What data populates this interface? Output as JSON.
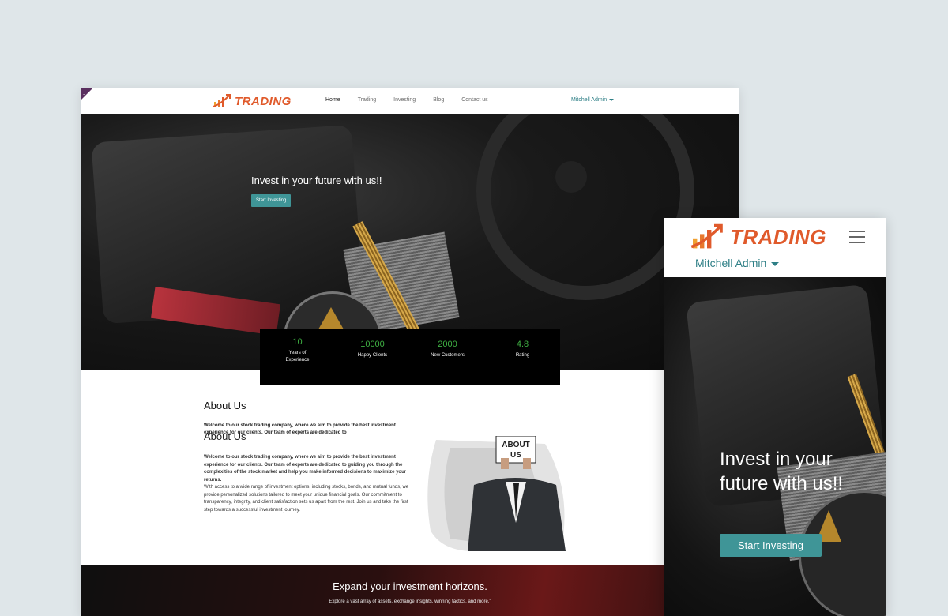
{
  "desktop": {
    "corner_glyph": "⌟",
    "logo_text": "TRADING",
    "nav": [
      "Home",
      "Trading",
      "Investing",
      "Blog",
      "Contact us"
    ],
    "nav_active": "Home",
    "user_menu": "Mitchell Admin",
    "hero": {
      "title": "Invest in your future with us!!",
      "button": "Start Investing"
    },
    "stats": [
      {
        "value": "10",
        "label": "Years of Experience"
      },
      {
        "value": "10000",
        "label": "Happy Clients"
      },
      {
        "value": "2000",
        "label": "New Customers"
      },
      {
        "value": "4.8",
        "label": "Rating"
      }
    ],
    "about": {
      "heading": "About Us",
      "intro": "Welcome to our stock trading company, where we aim to provide the best investment experience for our clients. Our team of experts are dedicated to",
      "ghost_heading": "About Us",
      "para_bold": "Welcome to our stock trading company, where we aim to provide the best investment experience for our clients. Our team of experts are dedicated to guiding you through the complexities of the stock market and help you make informed decisions to maximize your returns.",
      "para_rest": "With access to a wide range of investment options, including stocks, bonds, and mutual funds, we provide personalized solutions tailored to meet your unique financial goals. Our commitment to transparency, integrity, and client satisfaction sets us apart from the rest. Join us and take the first step towards a successful investment journey.",
      "image_sign": "ABOUT US"
    },
    "banner": {
      "heading": "Expand your investment horizons.",
      "text": "Explore a vast array of assets, exchange insights, winning tactics, and more.\""
    }
  },
  "mobile": {
    "logo_text": "TRADING",
    "user_menu": "Mitchell Admin",
    "hero_title": "Invest in your future with us!!",
    "button": "Start Investing"
  },
  "colors": {
    "brand": "#e05a2b",
    "accent": "#3f9597",
    "stat_green": "#3fb043",
    "link_teal": "#2e7f86"
  }
}
